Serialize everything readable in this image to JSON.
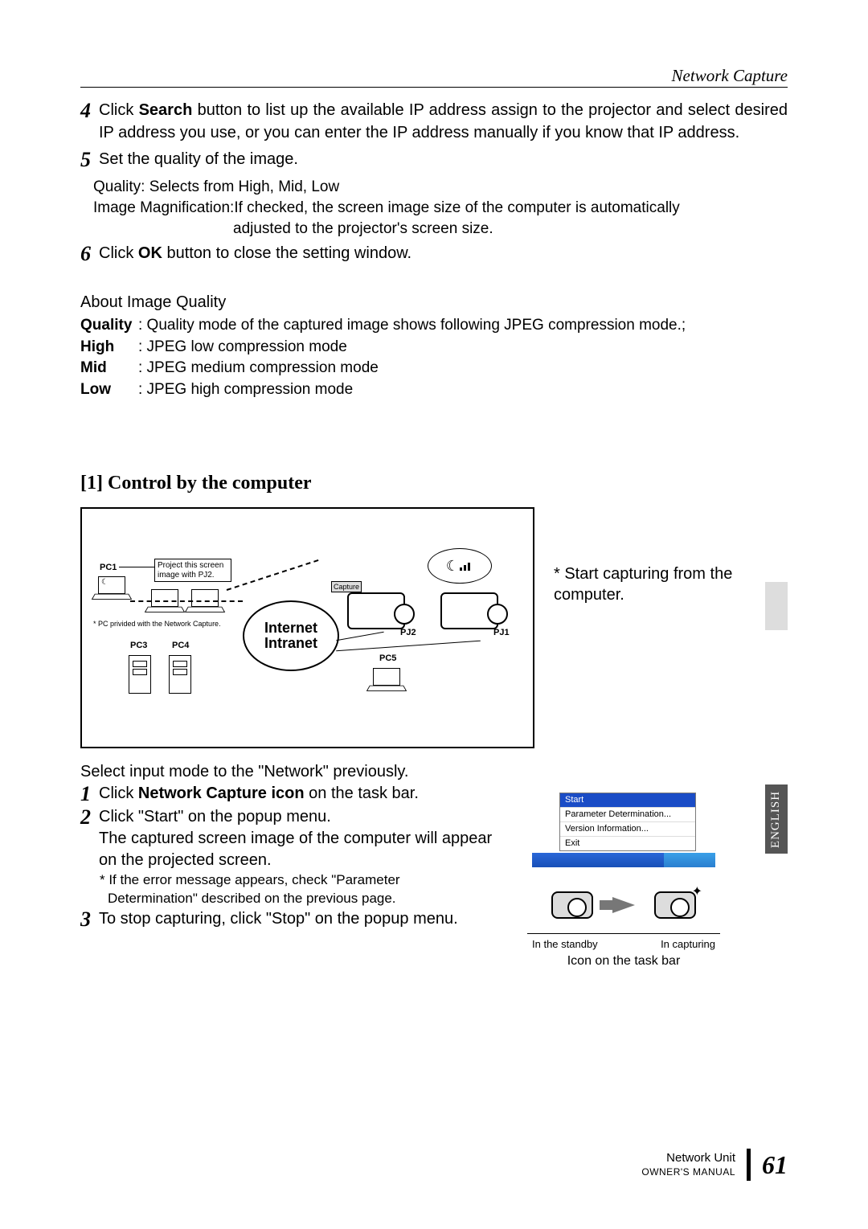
{
  "header": {
    "running": "Network Capture"
  },
  "steps_top": {
    "s4": {
      "num": "4",
      "pre": "Click ",
      "bold": "Search",
      "post": " button to list up the available IP address assign to the projector and select desired IP address you use, or you can enter the IP address manually if you know that IP address."
    },
    "s5": {
      "num": "5",
      "line": "Set the quality of the image.",
      "quality": "Quality: Selects from High, Mid, Low",
      "mag_label": "Image Magnification: ",
      "mag_text": "If checked, the screen image size of the computer is automatically",
      "mag_text2": "adjusted to the projector's screen size."
    },
    "s6": {
      "num": "6",
      "pre": "Click ",
      "bold": "OK",
      "post": " button to close the setting window."
    }
  },
  "about": {
    "heading": "About Image Quality",
    "rows": {
      "quality": {
        "term": "Quality",
        "desc": ": Quality mode of the captured image shows following JPEG compression mode.;"
      },
      "high": {
        "term": "High",
        "desc": ": JPEG low compression mode"
      },
      "mid": {
        "term": "Mid",
        "desc": ": JPEG medium compression mode"
      },
      "low": {
        "term": "Low",
        "desc": ": JPEG high compression mode"
      }
    }
  },
  "section": {
    "heading": "[1] Control by the computer"
  },
  "diagram": {
    "pc1": "PC1",
    "pc3": "PC3",
    "pc4": "PC4",
    "pc5": "PC5",
    "pj1": "PJ1",
    "pj2": "PJ2",
    "callout": "Project this screen image with PJ2.",
    "note": "* PC privided with the Network Capture.",
    "capture_btn": "Capture",
    "center": "Internet\nIntranet",
    "side_caption": "* Start capturing from the computer."
  },
  "lower": {
    "intro": "Select input mode to the \"Network\" previously.",
    "s1": {
      "num": "1",
      "pre": "Click ",
      "bold": "Network Capture icon",
      "post": " on the task bar."
    },
    "s2": {
      "num": "2",
      "l1": "Click \"Start\" on the popup menu.",
      "l2": "The captured screen image of the computer will appear on the projected screen.",
      "note1": "* If the error message appears, check \"Parameter",
      "note2": "Determination\" described on the previous page."
    },
    "s3": {
      "num": "3",
      "text": "To stop capturing, click \"Stop\" on the popup menu."
    }
  },
  "popup": {
    "items": {
      "start": "Start",
      "param": "Parameter Determination...",
      "ver": "Version Information...",
      "exit": "Exit"
    }
  },
  "icon_block": {
    "left": "In the standby",
    "right": "In capturing",
    "bar": "Icon on the task bar"
  },
  "lang_tab": "ENGLISH",
  "footer": {
    "unit": "Network Unit",
    "manual": "OWNER'S MANUAL",
    "page": "61"
  }
}
